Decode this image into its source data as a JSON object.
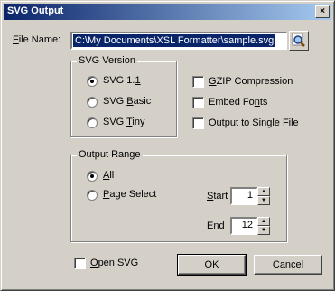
{
  "window": {
    "title": "SVG Output",
    "close_glyph": "×"
  },
  "file": {
    "label_accel": "F",
    "label_rest": "ile Name:",
    "value": "C:\\My Documents\\XSL Formatter\\sample.svg",
    "browse_icon": "magnifier-icon"
  },
  "svg_version": {
    "title": "SVG Version",
    "options": [
      {
        "accel": "",
        "before": "SVG 1.",
        "mid": "1",
        "after": "",
        "checked": true
      },
      {
        "accel": "",
        "before": "SVG ",
        "mid": "B",
        "after": "asic",
        "checked": false
      },
      {
        "accel": "",
        "before": "SVG ",
        "mid": "T",
        "after": "iny",
        "checked": false
      }
    ]
  },
  "options": [
    {
      "before": "",
      "mid": "G",
      "after": "ZIP Compression",
      "checked": false
    },
    {
      "before": "Embed Fo",
      "mid": "n",
      "after": "ts",
      "checked": false
    },
    {
      "before": "Output to Single File",
      "mid": "",
      "after": "",
      "checked": false
    }
  ],
  "output_range": {
    "title": "Output Range",
    "all": {
      "mid": "A",
      "after": "ll",
      "checked": true
    },
    "page_select": {
      "mid": "P",
      "after": "age Select",
      "checked": false
    },
    "start": {
      "mid": "S",
      "after": "tart",
      "value": "1"
    },
    "end": {
      "mid": "E",
      "after": "nd",
      "value": "12"
    }
  },
  "open_svg": {
    "mid": "O",
    "after": "pen SVG",
    "checked": false
  },
  "buttons": {
    "ok": "OK",
    "cancel": "Cancel"
  },
  "spin_glyphs": {
    "up": "▲",
    "down": "▼"
  }
}
